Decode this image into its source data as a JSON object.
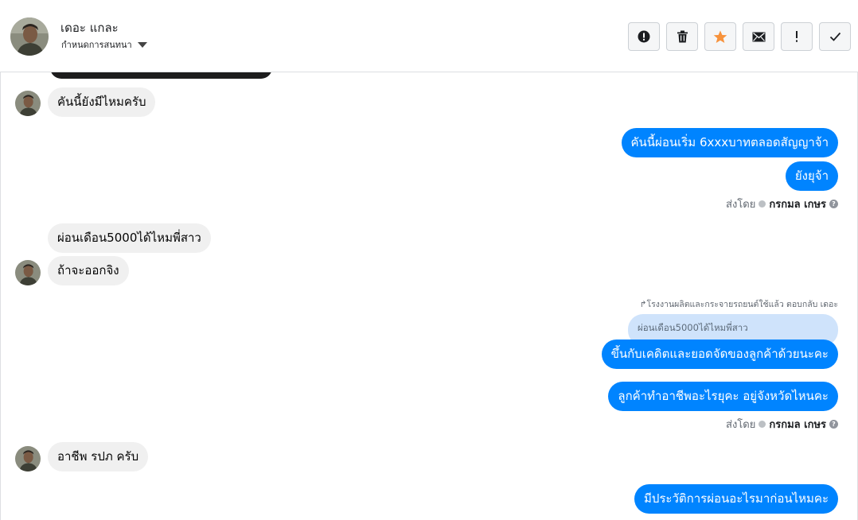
{
  "header": {
    "name": "เดอะ แกละ",
    "assign_label": "กำหนดการสนทนา",
    "actions": [
      {
        "name": "spam-button",
        "icon": "exclamation-circle-icon"
      },
      {
        "name": "delete-button",
        "icon": "trash-icon"
      },
      {
        "name": "star-button",
        "icon": "star-icon",
        "color": "#f7923b"
      },
      {
        "name": "unread-button",
        "icon": "envelope-icon"
      },
      {
        "name": "follow-up-button",
        "icon": "exclamation-icon"
      },
      {
        "name": "done-button",
        "icon": "check-icon"
      }
    ]
  },
  "messages": {
    "m1": "คันนี้ยังมีไหมครับ",
    "m2": "คันนี้ผ่อนเริ่ม 6xxxบาทตลอดสัญญาจ้า",
    "m3": "ยังยุจ้า",
    "m4": "ผ่อนเดือน5000ได้ไหมพี่สาว",
    "m5": "ถ้าจะออกจิง",
    "reply_note": "↱โรงงานผลิตและกระจายรถยนต์ใช้แล้ว ตอบกลับ เดอะ",
    "quote": "ผ่อนเดือน5000ได้ไหมพี่สาว",
    "m6": "ขึ้นกับเคดิตและยอดจัดของลูกค้าด้วยนะคะ",
    "m7": "ลูกค้าทำอาชีพอะไรยุคะ อยู่จังหวัดไหนคะ",
    "m8": "อาชีพ รปภ ครับ",
    "m9": "มีประวัติการผ่อนอะไรมาก่อนไหมคะ"
  },
  "sent_by": {
    "prefix": "ส่งโดย",
    "agent": "กรกมล เกษร"
  },
  "colors": {
    "outgoing": "#0084ff",
    "incoming": "#f0f0f0",
    "quote": "#cfe3fb"
  }
}
